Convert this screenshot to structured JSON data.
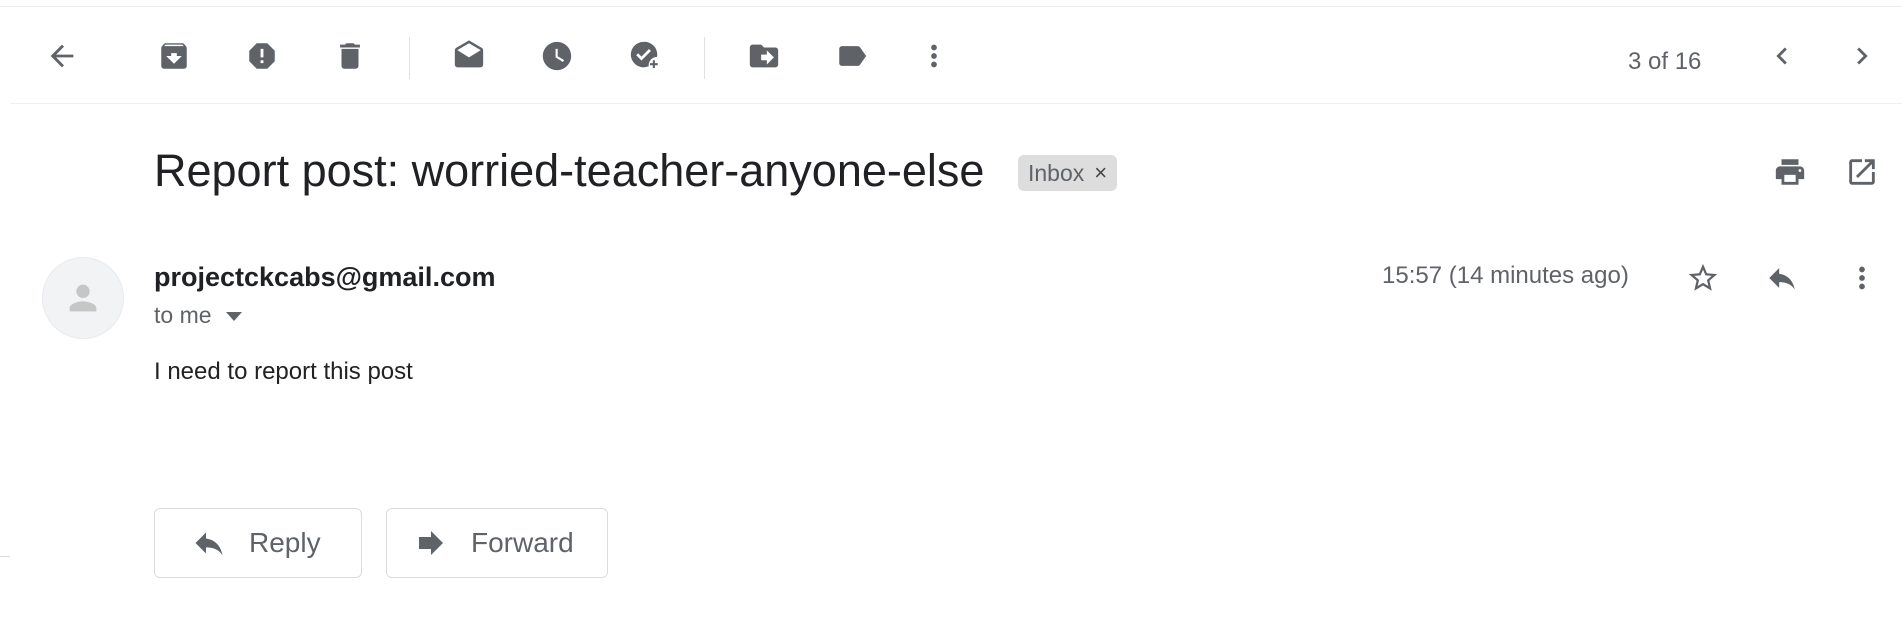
{
  "toolbar": {
    "counter": "3 of 16",
    "icons": [
      "back-arrow-icon",
      "archive-icon",
      "report-spam-icon",
      "delete-icon",
      "mark-unread-icon",
      "snooze-icon",
      "add-to-tasks-icon",
      "move-to-icon",
      "labels-icon",
      "more-vert-icon",
      "newer-chevron-icon",
      "older-chevron-icon"
    ]
  },
  "email": {
    "subject": "Report post: worried-teacher-anyone-else",
    "label": "Inbox",
    "label_remove": "×",
    "sender": "projectckcabs@gmail.com",
    "recipient": "to me",
    "time": "15:57 (14 minutes ago)",
    "body": "I need to report this post"
  },
  "actions": {
    "reply": "Reply",
    "forward": "Forward"
  },
  "colors": {
    "icon": "#5f6368",
    "chip_bg": "#dddddd",
    "text": "#202124"
  }
}
